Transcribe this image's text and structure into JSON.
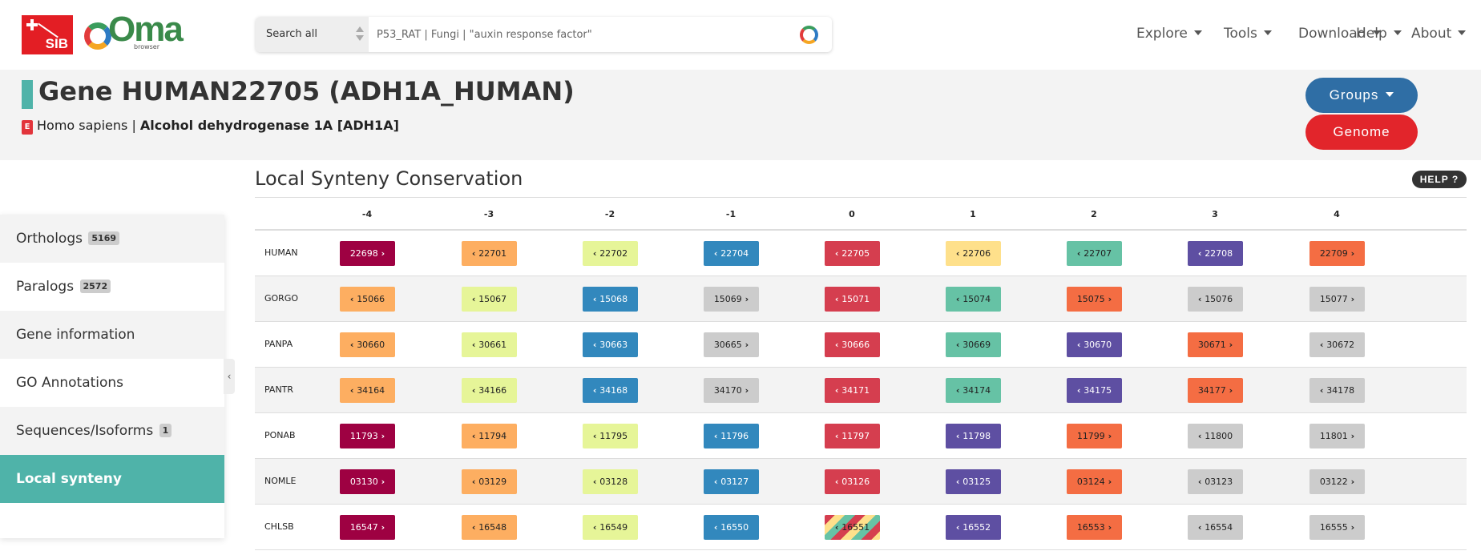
{
  "brand": {
    "sib": "SIB",
    "oma": "Oma",
    "oma_sub": "browser"
  },
  "search": {
    "scope": "Search all",
    "placeholder": "P53_RAT | Fungi | \"auxin response factor\""
  },
  "nav": {
    "explore": "Explore",
    "tools": "Tools",
    "download": "Download",
    "help": "Help",
    "about": "About"
  },
  "gene": {
    "title": "Gene HUMAN22705 (ADH1A_HUMAN)",
    "domain_badge": "E",
    "species": "Homo sapiens",
    "separator": "|",
    "description": "Alcohol dehydrogenase 1A [ADH1A]"
  },
  "buttons": {
    "groups": "Groups",
    "genome": "Genome",
    "help": "HELP ?"
  },
  "sidebar": {
    "items": [
      {
        "label": "Orthologs",
        "badge": "5169"
      },
      {
        "label": "Paralogs",
        "badge": "2572"
      },
      {
        "label": "Gene information"
      },
      {
        "label": "GO Annotations"
      },
      {
        "label": "Sequences/Isoforms",
        "badge": "1"
      },
      {
        "label": "Local synteny"
      }
    ],
    "collapse_glyph": "‹"
  },
  "synteny": {
    "title": "Local Synteny Conservation",
    "columns": [
      "-4",
      "-3",
      "-2",
      "-1",
      "0",
      "1",
      "2",
      "3",
      "4"
    ],
    "rows": [
      {
        "species": "HUMAN",
        "genes": [
          {
            "id": "22698",
            "dir": "right",
            "color": "#9e0142"
          },
          {
            "id": "22701",
            "dir": "left",
            "color": "#fdae61"
          },
          {
            "id": "22702",
            "dir": "left",
            "color": "#e6f598"
          },
          {
            "id": "22704",
            "dir": "left",
            "color": "#3288bd"
          },
          {
            "id": "22705",
            "dir": "left",
            "color": "#d53e4f"
          },
          {
            "id": "22706",
            "dir": "left",
            "color": "#fee08b"
          },
          {
            "id": "22707",
            "dir": "left",
            "color": "#66c2a5"
          },
          {
            "id": "22708",
            "dir": "left",
            "color": "#5e4fa2"
          },
          {
            "id": "22709",
            "dir": "right",
            "color": "#f46d43"
          }
        ]
      },
      {
        "species": "GORGO",
        "genes": [
          {
            "id": "15066",
            "dir": "left",
            "color": "#fdae61"
          },
          {
            "id": "15067",
            "dir": "left",
            "color": "#e6f598"
          },
          {
            "id": "15068",
            "dir": "left",
            "color": "#3288bd"
          },
          {
            "id": "15069",
            "dir": "right",
            "color": "#cccccc"
          },
          {
            "id": "15071",
            "dir": "left",
            "color": "#d53e4f"
          },
          {
            "id": "15074",
            "dir": "left",
            "color": "#66c2a5"
          },
          {
            "id": "15075",
            "dir": "right",
            "color": "#f46d43"
          },
          {
            "id": "15076",
            "dir": "left",
            "color": "#cccccc"
          },
          {
            "id": "15077",
            "dir": "right",
            "color": "#cccccc"
          }
        ]
      },
      {
        "species": "PANPA",
        "genes": [
          {
            "id": "30660",
            "dir": "left",
            "color": "#fdae61"
          },
          {
            "id": "30661",
            "dir": "left",
            "color": "#e6f598"
          },
          {
            "id": "30663",
            "dir": "left",
            "color": "#3288bd"
          },
          {
            "id": "30665",
            "dir": "right",
            "color": "#cccccc"
          },
          {
            "id": "30666",
            "dir": "left",
            "color": "#d53e4f"
          },
          {
            "id": "30669",
            "dir": "left",
            "color": "#66c2a5"
          },
          {
            "id": "30670",
            "dir": "left",
            "color": "#5e4fa2"
          },
          {
            "id": "30671",
            "dir": "right",
            "color": "#f46d43"
          },
          {
            "id": "30672",
            "dir": "left",
            "color": "#cccccc"
          }
        ]
      },
      {
        "species": "PANTR",
        "genes": [
          {
            "id": "34164",
            "dir": "left",
            "color": "#fdae61"
          },
          {
            "id": "34166",
            "dir": "left",
            "color": "#e6f598"
          },
          {
            "id": "34168",
            "dir": "left",
            "color": "#3288bd"
          },
          {
            "id": "34170",
            "dir": "right",
            "color": "#cccccc"
          },
          {
            "id": "34171",
            "dir": "left",
            "color": "#d53e4f"
          },
          {
            "id": "34174",
            "dir": "left",
            "color": "#66c2a5"
          },
          {
            "id": "34175",
            "dir": "left",
            "color": "#5e4fa2"
          },
          {
            "id": "34177",
            "dir": "right",
            "color": "#f46d43"
          },
          {
            "id": "34178",
            "dir": "left",
            "color": "#cccccc"
          }
        ]
      },
      {
        "species": "PONAB",
        "genes": [
          {
            "id": "11793",
            "dir": "right",
            "color": "#9e0142"
          },
          {
            "id": "11794",
            "dir": "left",
            "color": "#fdae61"
          },
          {
            "id": "11795",
            "dir": "left",
            "color": "#e6f598"
          },
          {
            "id": "11796",
            "dir": "left",
            "color": "#3288bd"
          },
          {
            "id": "11797",
            "dir": "left",
            "color": "#d53e4f"
          },
          {
            "id": "11798",
            "dir": "left",
            "color": "#5e4fa2"
          },
          {
            "id": "11799",
            "dir": "right",
            "color": "#f46d43"
          },
          {
            "id": "11800",
            "dir": "left",
            "color": "#cccccc"
          },
          {
            "id": "11801",
            "dir": "right",
            "color": "#cccccc"
          }
        ]
      },
      {
        "species": "NOMLE",
        "genes": [
          {
            "id": "03130",
            "dir": "right",
            "color": "#9e0142"
          },
          {
            "id": "03129",
            "dir": "left",
            "color": "#fdae61"
          },
          {
            "id": "03128",
            "dir": "left",
            "color": "#e6f598"
          },
          {
            "id": "03127",
            "dir": "left",
            "color": "#3288bd"
          },
          {
            "id": "03126",
            "dir": "left",
            "color": "#d53e4f"
          },
          {
            "id": "03125",
            "dir": "left",
            "color": "#5e4fa2"
          },
          {
            "id": "03124",
            "dir": "right",
            "color": "#f46d43"
          },
          {
            "id": "03123",
            "dir": "left",
            "color": "#cccccc"
          },
          {
            "id": "03122",
            "dir": "right",
            "color": "#cccccc"
          }
        ]
      },
      {
        "species": "CHLSB",
        "genes": [
          {
            "id": "16547",
            "dir": "right",
            "color": "#9e0142"
          },
          {
            "id": "16548",
            "dir": "left",
            "color": "#fdae61"
          },
          {
            "id": "16549",
            "dir": "left",
            "color": "#e6f598"
          },
          {
            "id": "16550",
            "dir": "left",
            "color": "#3288bd"
          },
          {
            "id": "16551",
            "dir": "left",
            "color": "striped"
          },
          {
            "id": "16552",
            "dir": "left",
            "color": "#5e4fa2"
          },
          {
            "id": "16553",
            "dir": "right",
            "color": "#f46d43"
          },
          {
            "id": "16554",
            "dir": "left",
            "color": "#cccccc"
          },
          {
            "id": "16555",
            "dir": "right",
            "color": "#cccccc"
          }
        ]
      }
    ]
  }
}
